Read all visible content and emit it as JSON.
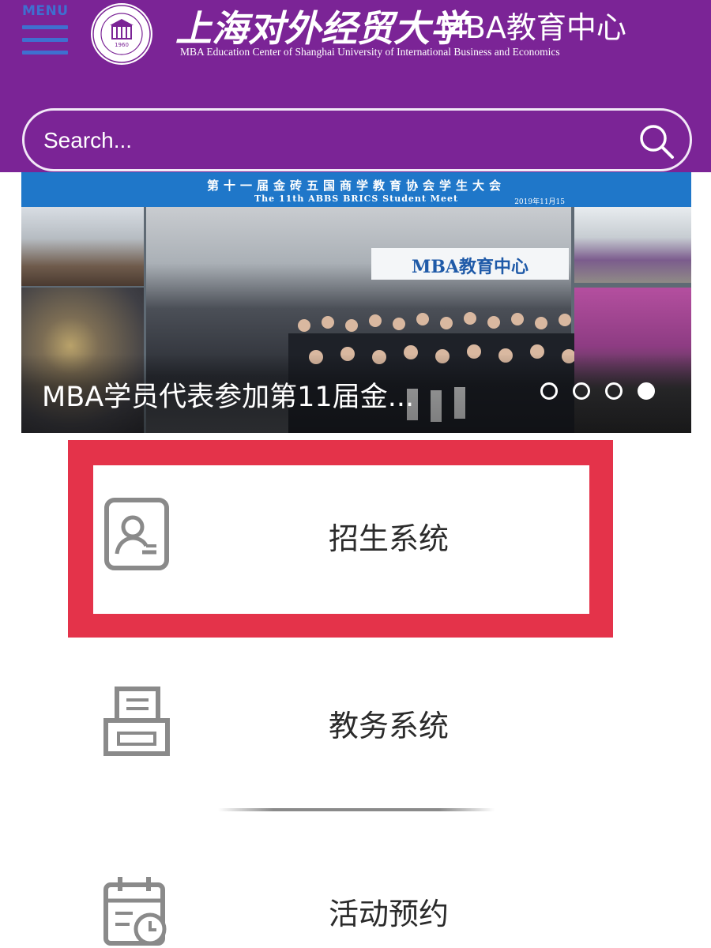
{
  "header": {
    "menu_label": "MENU",
    "logo_year": "1960",
    "title_cn": "上海对外经贸大学",
    "title_mba": "MBA教育中心",
    "title_en": "MBA Education Center of Shanghai University of International Business and Economics",
    "brand_color": "#7b2496"
  },
  "search": {
    "placeholder": "Search..."
  },
  "banner": {
    "headline_cn": "第十一届金砖五国商学教育协会学生大会",
    "headline_en": "The 11th ABBS BRICS Student Meet",
    "date": "2019年11月15",
    "sign_text": "MBA教育中心",
    "caption": "MBA学员代表参加第11届金...",
    "slide_count": 4,
    "active_slide": 4
  },
  "menu_items": [
    {
      "label": "招生系统",
      "icon": "user-card-icon",
      "highlighted": true
    },
    {
      "label": "教务系统",
      "icon": "printer-icon",
      "highlighted": false
    },
    {
      "label": "活动预约",
      "icon": "calendar-clock-icon",
      "highlighted": false
    }
  ],
  "colors": {
    "highlight_border": "#e4334a",
    "icon_gray": "#8a8a8a"
  }
}
